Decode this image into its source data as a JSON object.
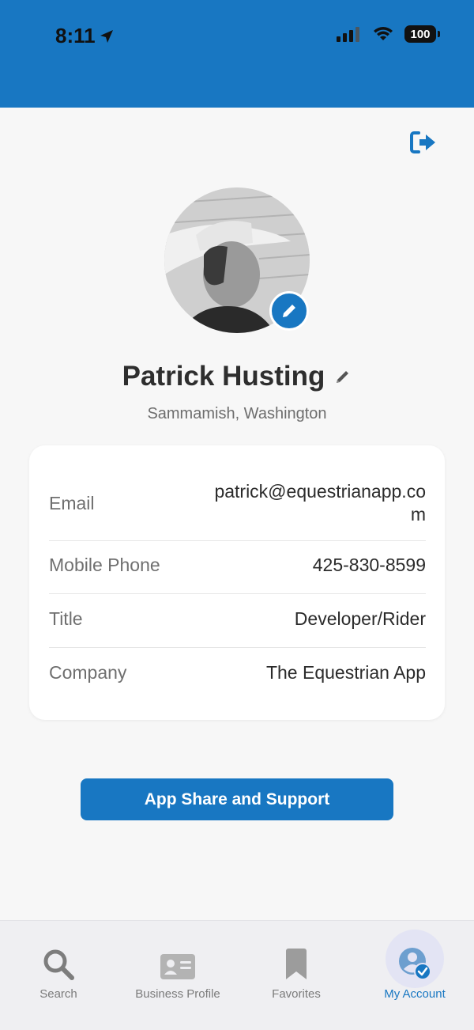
{
  "status_bar": {
    "time": "8:11",
    "battery": "100"
  },
  "profile": {
    "name": "Patrick Husting",
    "location": "Sammamish, Washington"
  },
  "details": [
    {
      "label": "Email",
      "value": "patrick@equestrianapp.com"
    },
    {
      "label": "Mobile Phone",
      "value": "425-830-8599"
    },
    {
      "label": "Title",
      "value": "Developer/Rider"
    },
    {
      "label": "Company",
      "value": "The Equestrian App"
    }
  ],
  "actions": {
    "support_button": "App Share and Support"
  },
  "tabs": [
    {
      "label": "Search",
      "icon": "search-icon"
    },
    {
      "label": "Business Profile",
      "icon": "id-card-icon"
    },
    {
      "label": "Favorites",
      "icon": "bookmark-icon"
    },
    {
      "label": "My Account",
      "icon": "account-icon",
      "active": true
    }
  ],
  "colors": {
    "brand": "#1877c2",
    "background": "#f7f7f7",
    "tab_active_bg": "#e3e4f4"
  }
}
